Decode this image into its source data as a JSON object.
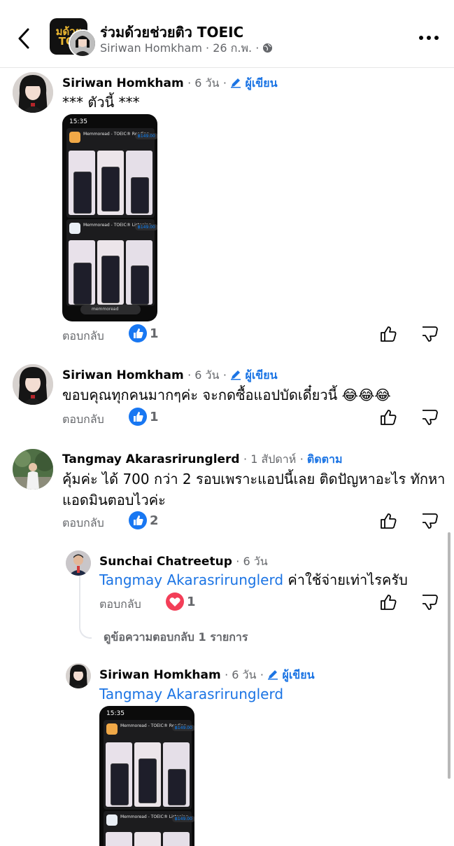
{
  "header": {
    "group_name": "ร่วมด้วยช่วยติว TOEIC",
    "poster": "Siriwan Homkham",
    "date": "26 ก.พ.",
    "dot": "·",
    "thumb_text": "มด้วย\nTOI",
    "icons": {
      "back": "chevron-left-icon",
      "globe": "globe-icon",
      "more": "more-horizontal-icon"
    }
  },
  "comments": [
    {
      "author": "Siriwan Homkham",
      "time": "6 วัน",
      "badge": "ผู้เขียน",
      "text": "*** ตัวนี้ ***",
      "reply_label": "ตอบกลับ",
      "reaction_count": "1",
      "reaction": "like"
    },
    {
      "author": "Siriwan Homkham",
      "time": "6 วัน",
      "badge": "ผู้เขียน",
      "text": "ขอบคุณทุกคนมากๆค่ะ จะกดซื้อแอปบัดเดี๋ยวนี้ 😂😂😂",
      "reply_label": "ตอบกลับ",
      "reaction_count": "1",
      "reaction": "like"
    },
    {
      "author": "Tangmay Akarasrirunglerd",
      "time": "1 สัปดาห์",
      "follow": "ติดตาม",
      "text_line1": "คุ้มค่ะ ได้ 700 กว่า 2 รอบเพราะแอปนี้เลย ติดปัญหาอะไร ทักหา",
      "text_line2": "แอดมินตอบไวค่ะ",
      "reply_label": "ตอบกลับ",
      "reaction_count": "2",
      "reaction": "like"
    }
  ],
  "replies": [
    {
      "author": "Sunchai Chatreetup",
      "time": "6 วัน",
      "mention": "Tangmay Akarasrirunglerd",
      "text": "ค่าใช้จ่ายเท่าไรครับ",
      "reply_label": "ตอบกลับ",
      "reaction_count": "1",
      "reaction": "love"
    },
    {
      "author": "Siriwan Homkham",
      "time": "6 วัน",
      "badge": "ผู้เขียน",
      "mention": "Tangmay Akarasrirunglerd"
    }
  ],
  "view_replies": "ดูข้อความตอบกลับ 1 รายการ",
  "screenshot": {
    "status_time": "15:35",
    "app1_title": "Memmoread - TOEIC® Reading",
    "app2_title": "Memmoread - TOEIC® Listening",
    "price": "฿149.00",
    "search_text": "memmoread"
  },
  "colors": {
    "link": "#1b74e4",
    "secondary_text": "#65676b",
    "like_blue": "#1877f2",
    "love_red": "#f33e58"
  }
}
